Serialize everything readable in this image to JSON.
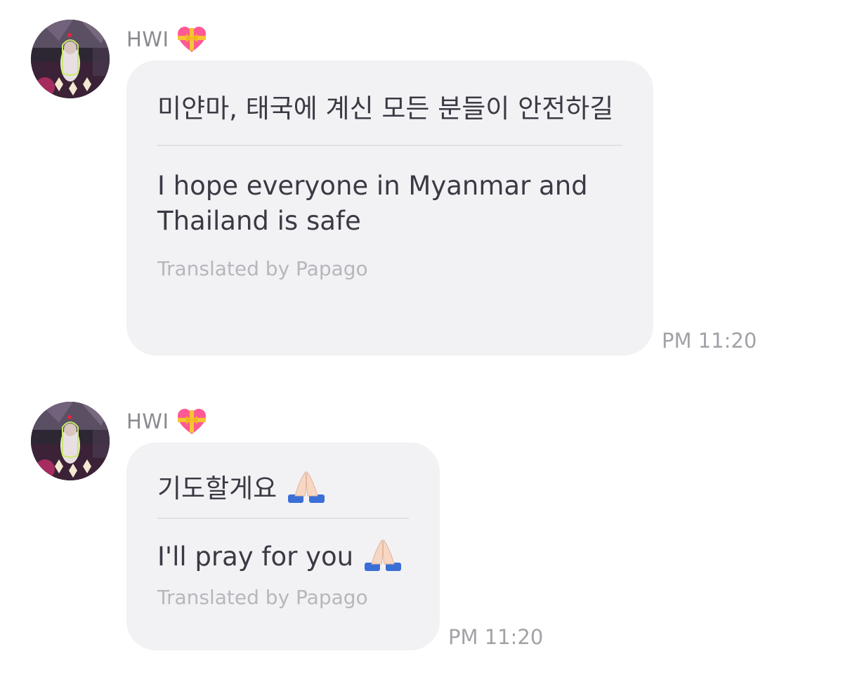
{
  "messages": [
    {
      "sender": "HWI",
      "original": "미얀마, 태국에 계신 모든 분들이 안전하길",
      "translation": "I hope everyone in Myanmar and Thailand is safe",
      "credit": "Translated by Papago",
      "time": "PM 11:20",
      "icons": [
        "heart-with-ribbon-icon"
      ]
    },
    {
      "sender": "HWI",
      "original": "기도할게요",
      "translation": "I'll pray for you",
      "credit": "Translated by Papago",
      "time": "PM 11:20",
      "icons": [
        "heart-with-ribbon-icon",
        "folded-hands-icon"
      ]
    }
  ],
  "colors": {
    "bubble": "#f2f2f5",
    "text": "#3a3a44",
    "muted": "#a2a2a8",
    "heart": "#ff4f8b",
    "ribbon": "#f6c531"
  }
}
